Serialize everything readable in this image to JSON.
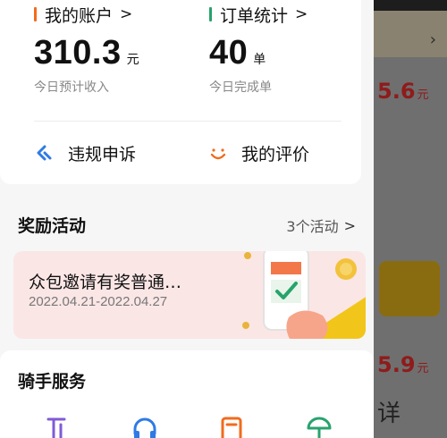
{
  "account": {
    "title": "我的账户",
    "value": "310.3",
    "unit": "元",
    "sub": "今日预计收入"
  },
  "orders": {
    "title": "订单统计",
    "value": "40",
    "unit": "单",
    "sub": "今日完成单"
  },
  "actions": {
    "appeal_label": "违规申诉",
    "review_label": "我的评价"
  },
  "rewards": {
    "title": "奖励活动",
    "more_label": "3个活动",
    "banner": {
      "title": "众包邀请有奖普通…",
      "date_range": "2022.04.21-2022.04.27"
    }
  },
  "rider_services": {
    "title": "骑手服务",
    "icons": [
      "music-icon",
      "headset-icon",
      "document-icon",
      "umbrella-icon"
    ]
  },
  "backdrop": {
    "amount_1": "5.6",
    "amount_2": "5.9",
    "unit": "元",
    "glyph": "详"
  },
  "colors": {
    "accent_orange": "#f26b1d",
    "accent_green": "#27a36c",
    "accent_blue": "#2f7be4",
    "purple": "#7f5bd6",
    "banner_bg": "#fbe6e6"
  }
}
